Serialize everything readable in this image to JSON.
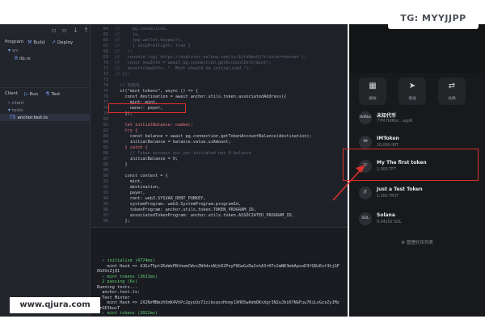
{
  "sidebar": {
    "section_program": "Program",
    "build_label": "Build",
    "deploy_label": "Deploy",
    "src_folder": "src",
    "lib_file": "lib.rs",
    "section_client": "Client",
    "run_label": "Run",
    "test_label": "Test",
    "client_folder": "client",
    "tests_folder": "tests",
    "test_file": "anchor.test.ts"
  },
  "editor": {
    "lines": [
      {
        "n": "64",
        "t": "//     pg.connection,",
        "k": "c"
      },
      {
        "n": "65",
        "t": "//     tx,",
        "k": "c"
      },
      {
        "n": "66",
        "t": "//     [pg.wallet.keypair],",
        "k": "c"
      },
      {
        "n": "67",
        "t": "//     { skipPreflight: true }",
        "k": "c"
      },
      {
        "n": "68",
        "t": "//   );",
        "k": "c"
      },
      {
        "n": "69",
        "t": "//   console.log(`https://explorer.solana.com/tx/${txHash}?cluster=devnet`);",
        "k": "c"
      },
      {
        "n": "70",
        "t": "//   const newInfo = await pg.connection.getAccountInfo(mint);",
        "k": "c"
      },
      {
        "n": "71",
        "t": "//   assert(newInfo, \"  Mint should be initialized.\");",
        "k": "c"
      },
      {
        "n": "72",
        "t": "// });",
        "k": "c"
      },
      {
        "n": "73",
        "t": "",
        "k": ""
      },
      {
        "n": "74",
        "t": "  // 初始化",
        "k": "c"
      },
      {
        "n": "75",
        "t": "  it(\"mint tokens\", async () => {",
        "k": ""
      },
      {
        "n": "76",
        "t": "    const destination = await anchor.utils.token.associatedAddress({",
        "k": ""
      },
      {
        "n": "77",
        "t": "      mint: mint,",
        "k": ""
      },
      {
        "n": "78",
        "t": "      owner: payer,",
        "k": ""
      },
      {
        "n": "79",
        "t": "    });",
        "k": ""
      },
      {
        "n": "80",
        "t": "",
        "k": ""
      },
      {
        "n": "81",
        "t": "    let initialBalance: number;",
        "k": "k"
      },
      {
        "n": "82",
        "t": "    try {",
        "k": "k"
      },
      {
        "n": "83",
        "t": "      const balance = await pg.connection.getTokenAccountBalance(destination);",
        "k": ""
      },
      {
        "n": "84",
        "t": "      initialBalance = balance.value.uiAmount;",
        "k": ""
      },
      {
        "n": "85",
        "t": "    } catch {",
        "k": "k"
      },
      {
        "n": "86",
        "t": "      // Token account not yet initiated has 0 balance",
        "k": "c"
      },
      {
        "n": "87",
        "t": "      initialBalance = 0;",
        "k": ""
      },
      {
        "n": "88",
        "t": "    }",
        "k": ""
      },
      {
        "n": "89",
        "t": "",
        "k": ""
      },
      {
        "n": "90",
        "t": "    const context = {",
        "k": ""
      },
      {
        "n": "91",
        "t": "      mint,",
        "k": ""
      },
      {
        "n": "92",
        "t": "      destination,",
        "k": ""
      },
      {
        "n": "93",
        "t": "      payer,",
        "k": ""
      },
      {
        "n": "94",
        "t": "      rent: web3.SYSVAR_RENT_PUBKEY,",
        "k": ""
      },
      {
        "n": "95",
        "t": "      systemProgram: web3.SystemProgram.programId,",
        "k": ""
      },
      {
        "n": "96",
        "t": "      tokenProgram: anchor.utils.token.TOKEN_PROGRAM_ID,",
        "k": ""
      },
      {
        "n": "97",
        "t": "      associatedTokenProgram: anchor.utils.token.ASSOCIATED_PROGRAM_ID,",
        "k": ""
      },
      {
        "n": "98",
        "t": "    };",
        "k": ""
      }
    ]
  },
  "terminal": {
    "lines": [
      {
        "t": "  ✓ initialize (4774ms)",
        "k": "g"
      },
      {
        "t": "    mint Hash => 4JGvT5pt2KeWzPBthomCWvxZW4dznNjkD2PoyF8GwGzRa2shA3rH7s2mNK3mbApsoD3fGNiEut3hjGF",
        "k": ""
      },
      {
        "t": "6GXVxZjQ1",
        "k": ""
      },
      {
        "t": "  ✓ mint tokens (3631ms)",
        "k": "g"
      },
      {
        "t": "  2 passing (6s)",
        "k": "g"
      },
      {
        "t": "Running tests...",
        "k": ""
      },
      {
        "t": "  anchor.test.ts:",
        "k": ""
      },
      {
        "t": "  Test Minter",
        "k": ""
      },
      {
        "t": "    mint Hash => 2X2NzMBmzh5mK4VhPc2pyoUz71cikxqssHcmy1XHQ5wAdmQKsXgr3N2uJbiKYNGFuu7KiLvGzzZyJMz",
        "k": ""
      },
      {
        "t": "rrGE3busT",
        "k": ""
      },
      {
        "t": "  ✓ mint tokens (2022ms)",
        "k": "g"
      }
    ]
  },
  "wallet": {
    "actions": [
      {
        "label": "接收",
        "icon": "grid-icon"
      },
      {
        "label": "发送",
        "icon": "send-icon"
      },
      {
        "label": "兑换",
        "icon": "swap-icon"
      }
    ],
    "tokens": [
      {
        "name": "未知代币",
        "sub": "77M HdRbc...agoR",
        "avatar": "HdRbc"
      },
      {
        "name": "IMToken",
        "sub": "20,000 IMT",
        "avatar": "IM"
      },
      {
        "name": "My The first token",
        "sub": "2,000 TFT",
        "avatar": "TF"
      },
      {
        "name": "Just a Test Token",
        "sub": "1,000 TEST",
        "avatar": "JT"
      },
      {
        "name": "Solana",
        "sub": "9.04202 SOL",
        "avatar": "SOL"
      }
    ],
    "manage_label": "管理代币列表"
  },
  "overlay": {
    "tg_badge": "TG: MYYJJPP",
    "watermark": "www.qjura.com"
  },
  "colors": {
    "highlight": "#e0302b",
    "pass_green": "#5fcf73"
  }
}
